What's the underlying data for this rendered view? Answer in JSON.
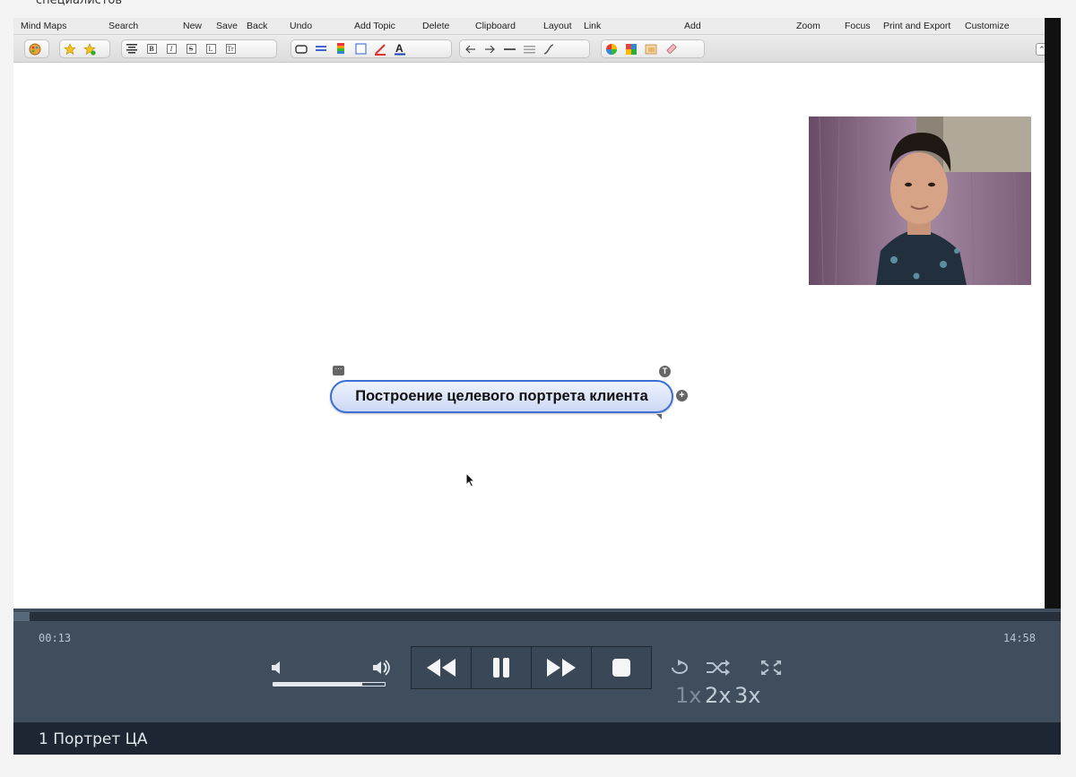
{
  "page": {
    "cut_off_text": "специалистов"
  },
  "menubar": {
    "items": [
      "Mind Maps",
      "Search",
      "New",
      "Save",
      "Back",
      "Undo",
      "Add Topic",
      "Delete",
      "Clipboard",
      "Layout",
      "Link",
      "Add",
      "Zoom",
      "Focus",
      "Print and Export",
      "Customize"
    ]
  },
  "toolbar": {
    "icons": [
      "palette-icon",
      "star-icon",
      "star-plus-icon",
      "align-center-icon",
      "bold-icon",
      "italic-icon",
      "strikethrough-icon",
      "case-icon",
      "text-size-icon",
      "shape-icon",
      "line-style-icon",
      "color-bars-icon",
      "fill-icon",
      "pen-color-icon",
      "font-color-icon",
      "arrow-left-icon",
      "arrow-right-icon",
      "line-icon",
      "lines-icon",
      "curve-icon",
      "color-wheel-icon",
      "image-icon",
      "picture-icon",
      "eraser-icon"
    ],
    "collapse_icon": "chevron-up-icon"
  },
  "mindmap": {
    "central_topic": "Построение целевого портрета клиента"
  },
  "player": {
    "current_time": "00:13",
    "total_time": "14:58",
    "progress_fraction": 0.015,
    "volume_fraction": 0.8,
    "speed_options": [
      "1x",
      "2x",
      "3x"
    ],
    "active_speed": "2x"
  },
  "playlist": {
    "current_item": "1 Портрет ЦА"
  },
  "colors": {
    "player_bg": "#3f4d5c",
    "playlist_bg": "#1c2733",
    "topic_border": "#3c6fd6",
    "topic_fill": "#dbe4f8"
  }
}
